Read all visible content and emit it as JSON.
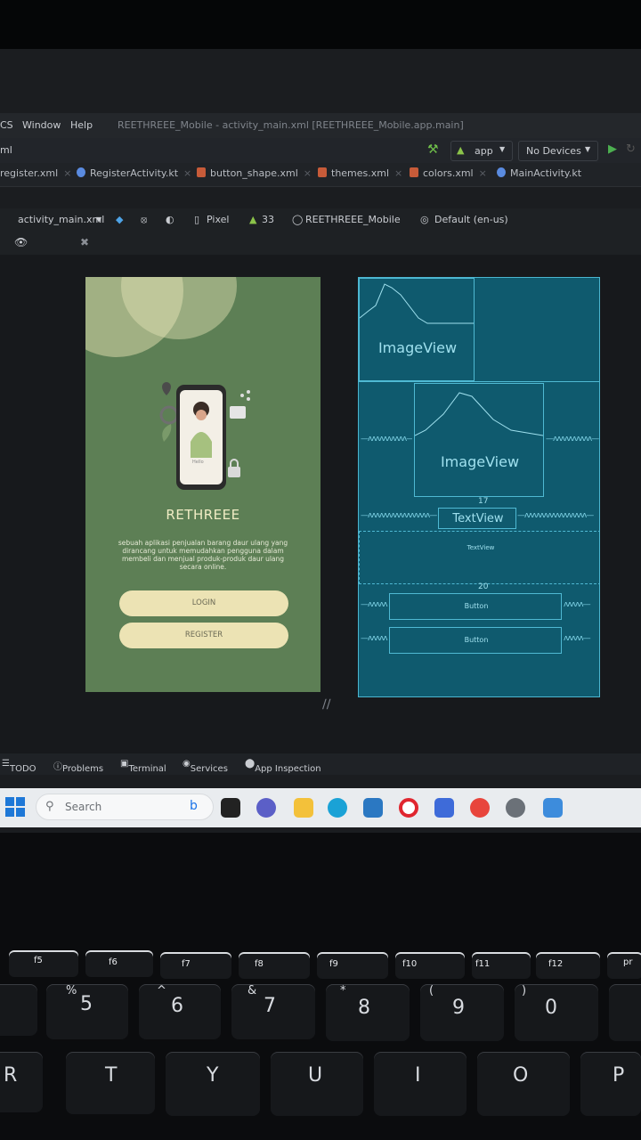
{
  "menu": {
    "vcs": "CS",
    "window": "Window",
    "help": "Help",
    "window_title": "REETHREEE_Mobile - activity_main.xml [REETHREEE_Mobile.app.main]"
  },
  "toolbar": {
    "left_fragment": "ml",
    "run_config": "app",
    "device": "No Devices"
  },
  "tabs": [
    {
      "label": "register.xml",
      "color": "#c75b39"
    },
    {
      "label": "RegisterActivity.kt",
      "color": "#5a8be0"
    },
    {
      "label": "button_shape.xml",
      "color": "#c75b39"
    },
    {
      "label": "themes.xml",
      "color": "#c75b39"
    },
    {
      "label": "colors.xml",
      "color": "#c75b39"
    },
    {
      "label": "MainActivity.kt",
      "color": "#5a8be0"
    }
  ],
  "design_toolbar": {
    "file": "activity_main.xml",
    "device": "Pixel",
    "api": "33",
    "theme": "REETHREEE_Mobile",
    "locale": "Default (en-us)"
  },
  "preview": {
    "title": "RETHREEE",
    "description": "sebuah aplikasi penjualan barang daur ulang yang dirancang untuk memudahkan pengguna dalam membeli dan menjual produk-produk daur ulang secara online.",
    "login": "LOGIN",
    "register": "REGISTER",
    "phone_caption": "Hello"
  },
  "blueprint": {
    "image1": "ImageView",
    "image2": "ImageView",
    "textview1": "TextView",
    "textview2": "TextView",
    "button1": "Button",
    "button2": "Button",
    "margin_top": "17",
    "margin_mid": "20"
  },
  "bottom": {
    "todo": "TODO",
    "problems": "Problems",
    "terminal": "Terminal",
    "services": "Services",
    "app_inspection": "App Inspection"
  },
  "taskbar": {
    "search": "Search"
  },
  "keys": {
    "fn": [
      "f5",
      "f6",
      "f7",
      "f8",
      "f9",
      "f10",
      "f11",
      "f12",
      "pr"
    ],
    "num_main": [
      "5",
      "6",
      "7",
      "8",
      "9",
      "0"
    ],
    "num_shift": [
      "%",
      "^",
      "&",
      "*",
      "(",
      ")"
    ],
    "letters": [
      "R",
      "T",
      "Y",
      "U",
      "I",
      "O",
      "P"
    ]
  }
}
